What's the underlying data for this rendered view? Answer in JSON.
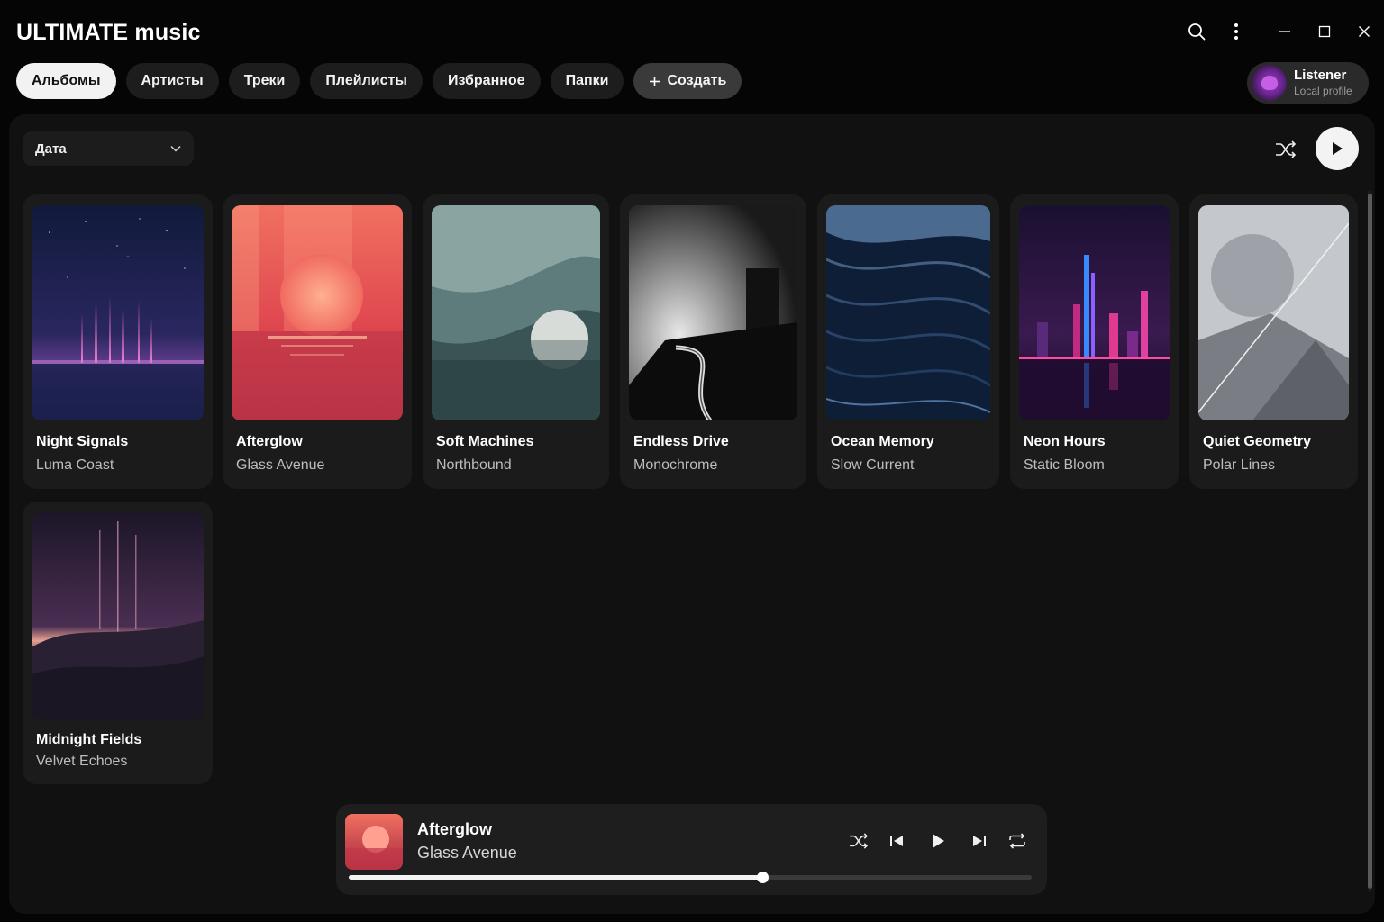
{
  "app": {
    "title": "ULTIMATE music"
  },
  "nav": {
    "tabs": [
      {
        "label": "Альбомы",
        "active": true
      },
      {
        "label": "Артисты",
        "active": false
      },
      {
        "label": "Треки",
        "active": false
      },
      {
        "label": "Плейлисты",
        "active": false
      },
      {
        "label": "Избранное",
        "active": false
      },
      {
        "label": "Папки",
        "active": false
      }
    ],
    "create_label": "Создать"
  },
  "profile": {
    "name": "Listener",
    "subtitle": "Local profile"
  },
  "toolbar": {
    "sort_label": "Дата"
  },
  "albums": [
    {
      "title": "Night Signals",
      "artist": "Luma Coast",
      "art": "night-signals"
    },
    {
      "title": "Afterglow",
      "artist": "Glass Avenue",
      "art": "afterglow"
    },
    {
      "title": "Soft Machines",
      "artist": "Northbound",
      "art": "soft-machines"
    },
    {
      "title": "Endless Drive",
      "artist": "Monochrome",
      "art": "endless-drive"
    },
    {
      "title": "Ocean Memory",
      "artist": "Slow Current",
      "art": "ocean-memory"
    },
    {
      "title": "Neon Hours",
      "artist": "Static Bloom",
      "art": "neon-hours"
    },
    {
      "title": "Quiet Geometry",
      "artist": "Polar Lines",
      "art": "quiet-geometry"
    },
    {
      "title": "Midnight Fields",
      "artist": "Velvet Echoes",
      "art": "midnight-fields"
    }
  ],
  "player": {
    "title": "Afterglow",
    "artist": "Glass Avenue",
    "progress": 0.605
  },
  "colors": {
    "background": "#050505",
    "panel": "#111111",
    "card": "#1b1b1b",
    "accent": "#f3f3f3"
  }
}
